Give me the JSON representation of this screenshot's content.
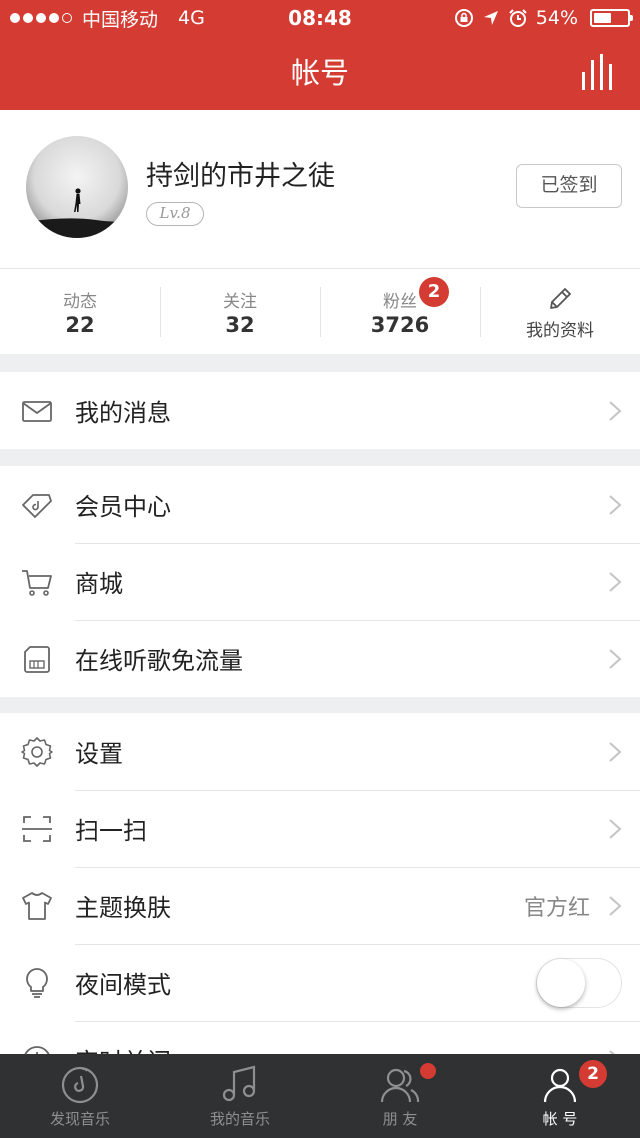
{
  "status_bar": {
    "carrier": "中国移动",
    "network": "4G",
    "time": "08:48",
    "battery": "54%",
    "battery_level": 0.54
  },
  "header": {
    "title": "帐号",
    "right_icon": "equalizer-icon",
    "background": "#d43c33"
  },
  "profile": {
    "username": "持剑的市井之徒",
    "level": "Lv.8",
    "signin_button": "已签到"
  },
  "stats": [
    {
      "label": "动态",
      "value": "22"
    },
    {
      "label": "关注",
      "value": "32"
    },
    {
      "label": "粉丝",
      "value": "3726",
      "badge": "2"
    },
    {
      "label": "我的资料",
      "icon": "edit-icon"
    }
  ],
  "sections": {
    "messages": [
      {
        "label": "我的消息",
        "icon": "mail-icon"
      }
    ],
    "services": [
      {
        "label": "会员中心",
        "icon": "diamond-tag-icon"
      },
      {
        "label": "商城",
        "icon": "cart-icon"
      },
      {
        "label": "在线听歌免流量",
        "icon": "sim-card-icon"
      }
    ],
    "settings": [
      {
        "label": "设置",
        "icon": "gear-icon"
      },
      {
        "label": "扫一扫",
        "icon": "scan-icon"
      },
      {
        "label": "主题换肤",
        "icon": "tshirt-icon",
        "value": "官方红"
      },
      {
        "label": "夜间模式",
        "icon": "bulb-icon",
        "toggle": false
      },
      {
        "label": "定时关闭",
        "icon": "clock-icon"
      }
    ]
  },
  "tabbar": {
    "tabs": [
      {
        "label": "发现音乐",
        "icon": "discover-music-icon",
        "active": false
      },
      {
        "label": "我的音乐",
        "icon": "music-note-icon",
        "active": false
      },
      {
        "label": "朋 友",
        "icon": "friends-icon",
        "active": false,
        "dot": true
      },
      {
        "label": "帐 号",
        "icon": "account-icon",
        "active": true,
        "badge": "2"
      }
    ]
  }
}
